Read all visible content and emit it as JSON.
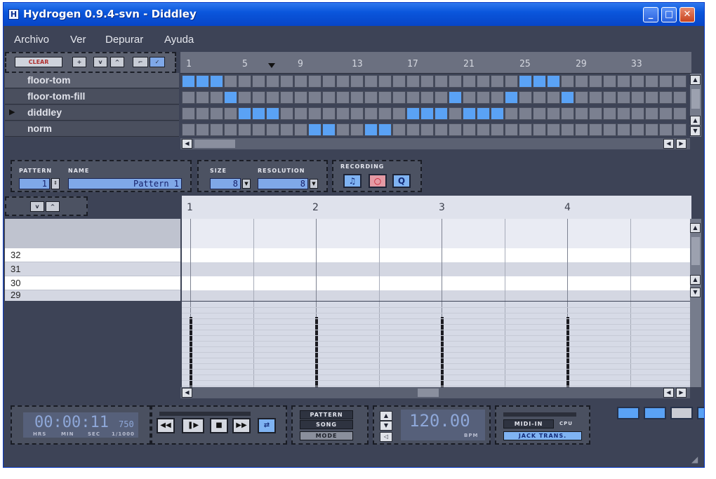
{
  "window": {
    "title": "Hydrogen 0.9.4-svn - Diddley",
    "app_icon": "H",
    "controls": {
      "minimize": "_",
      "maximize": "□",
      "close": "✕"
    }
  },
  "menu": [
    "Archivo",
    "Ver",
    "Depurar",
    "Ayuda"
  ],
  "song_toolbar": {
    "clear": "CLEAR",
    "add": "+",
    "down": "v",
    "up": "^",
    "draw": "⌐",
    "select": "✓"
  },
  "song_ruler": [
    "1",
    "5",
    "9",
    "13",
    "17",
    "21",
    "25",
    "29",
    "33"
  ],
  "tracks": [
    {
      "name": "floor-tom",
      "active_cells": [
        0,
        1,
        2,
        24,
        25,
        26
      ]
    },
    {
      "name": "floor-tom-fill",
      "active_cells": [
        3,
        19,
        23,
        27
      ]
    },
    {
      "name": "diddley",
      "active_cells": [
        4,
        5,
        6,
        16,
        17,
        18,
        20,
        21,
        22
      ]
    },
    {
      "name": "norm",
      "active_cells": [
        9,
        10,
        13,
        14
      ]
    }
  ],
  "selected_track_marker": "▶",
  "pattern_props": {
    "pattern_label": "PATTERN",
    "name_label": "NAME",
    "pattern_number": "1",
    "pattern_name": "Pattern 1",
    "size_label": "SIZE",
    "size_value": "8",
    "resolution_label": "RESOLUTION",
    "resolution_value": "8",
    "recording_label": "RECORDING"
  },
  "pattern_ruler": [
    "1",
    "2",
    "3",
    "4"
  ],
  "note_rows": [
    "32",
    "31",
    "30",
    "29"
  ],
  "transport": {
    "time": "00:00:11",
    "time_ms": "750",
    "time_units": [
      "HRS",
      "MIN",
      "SEC",
      "1/1000"
    ],
    "mode_pattern": "PATTERN",
    "mode_song": "SONG",
    "mode_button": "MODE",
    "bpm": "120.00",
    "bpm_label": "BPM",
    "midi_in": "MIDI-IN",
    "cpu": "CPU",
    "jack_trans": "JACK TRANS."
  },
  "colors": {
    "active_cell": "#5aa2f5",
    "inactive_cell": "#7b8090",
    "window_bg": "#3d4356",
    "titlebar": "#0a56dc"
  }
}
